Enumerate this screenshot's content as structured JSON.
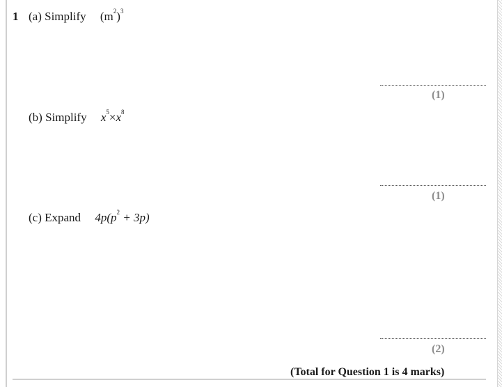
{
  "question": {
    "number": "1",
    "parts": [
      {
        "label": "(a) Simplify",
        "expression": {
          "open": "(m",
          "inner_exp": "2",
          "close": ")",
          "outer_exp": "3"
        },
        "marks": "(1)"
      },
      {
        "label": "(b) Simplify",
        "expression": {
          "base1": "x",
          "exp1": "5",
          "op": "×",
          "base2": "x",
          "exp2": "8"
        },
        "marks": "(1)"
      },
      {
        "label": "(c) Expand",
        "expression": {
          "prefix": "4p(p",
          "exp": "2",
          "rest": " + 3p)"
        },
        "marks": "(2)"
      }
    ],
    "total": "(Total for Question 1 is 4 marks)"
  }
}
